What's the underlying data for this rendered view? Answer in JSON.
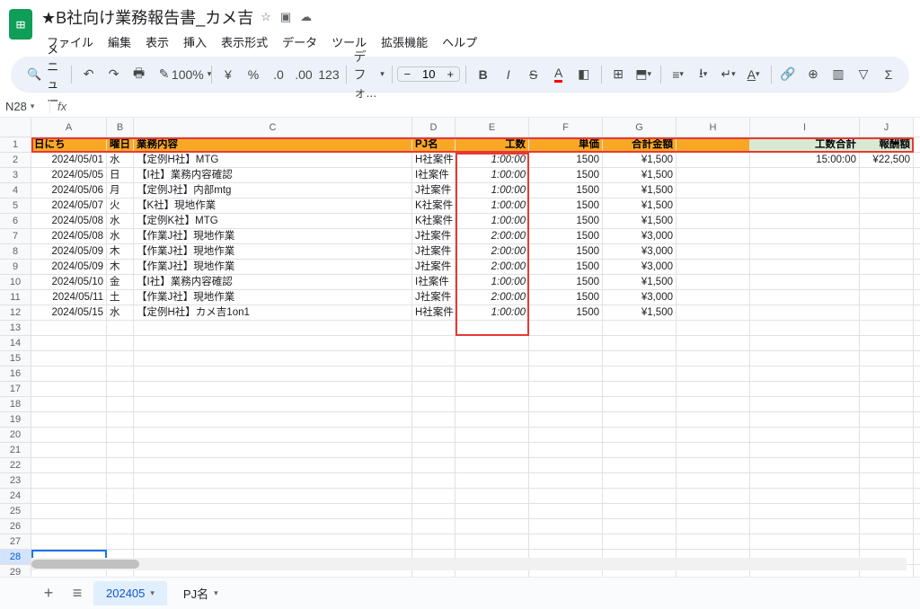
{
  "header": {
    "doc_title": "★B社向け業務報告書_カメ吉",
    "menu": [
      "ファイル",
      "編集",
      "表示",
      "挿入",
      "表示形式",
      "データ",
      "ツール",
      "拡張機能",
      "ヘルプ"
    ]
  },
  "toolbar": {
    "menu_label": "メニュー",
    "zoom": "100%",
    "font": "デフォ...",
    "font_size": "10"
  },
  "name_box": "N28",
  "columns": [
    "A",
    "B",
    "C",
    "D",
    "E",
    "F",
    "G",
    "H",
    "I",
    "J"
  ],
  "row_count": 29,
  "selected_row": 28,
  "table_headers": {
    "A": "日にち",
    "B": "曜日",
    "C": "業務内容",
    "D": "PJ名",
    "E": "工数",
    "F": "単価",
    "G": "合計金額",
    "H": "",
    "I": "工数合計",
    "J": "報酬額"
  },
  "rows": [
    {
      "date": "2024/05/01",
      "day": "水",
      "task": "【定例H社】MTG",
      "pj": "H社案件",
      "hours": "1:00:00",
      "unit": "1500",
      "total": "¥1,500",
      "sum_hours": "15:00:00",
      "pay": "¥22,500"
    },
    {
      "date": "2024/05/05",
      "day": "日",
      "task": "【I社】業務内容確認",
      "pj": "I社案件",
      "hours": "1:00:00",
      "unit": "1500",
      "total": "¥1,500"
    },
    {
      "date": "2024/05/06",
      "day": "月",
      "task": "【定例J社】内部mtg",
      "pj": "J社案件",
      "hours": "1:00:00",
      "unit": "1500",
      "total": "¥1,500"
    },
    {
      "date": "2024/05/07",
      "day": "火",
      "task": "【K社】現地作業",
      "pj": "K社案件",
      "hours": "1:00:00",
      "unit": "1500",
      "total": "¥1,500"
    },
    {
      "date": "2024/05/08",
      "day": "水",
      "task": "【定例K社】MTG",
      "pj": "K社案件",
      "hours": "1:00:00",
      "unit": "1500",
      "total": "¥1,500"
    },
    {
      "date": "2024/05/08",
      "day": "水",
      "task": "【作業J社】現地作業",
      "pj": "J社案件",
      "hours": "2:00:00",
      "unit": "1500",
      "total": "¥3,000"
    },
    {
      "date": "2024/05/09",
      "day": "木",
      "task": "【作業J社】現地作業",
      "pj": "J社案件",
      "hours": "2:00:00",
      "unit": "1500",
      "total": "¥3,000"
    },
    {
      "date": "2024/05/09",
      "day": "木",
      "task": "【作業J社】現地作業",
      "pj": "J社案件",
      "hours": "2:00:00",
      "unit": "1500",
      "total": "¥3,000"
    },
    {
      "date": "2024/05/10",
      "day": "金",
      "task": "【I社】業務内容確認",
      "pj": "I社案件",
      "hours": "1:00:00",
      "unit": "1500",
      "total": "¥1,500"
    },
    {
      "date": "2024/05/11",
      "day": "土",
      "task": "【作業J社】現地作業",
      "pj": "J社案件",
      "hours": "2:00:00",
      "unit": "1500",
      "total": "¥3,000"
    },
    {
      "date": "2024/05/15",
      "day": "水",
      "task": "【定例H社】カメ吉1on1",
      "pj": "H社案件",
      "hours": "1:00:00",
      "unit": "1500",
      "total": "¥1,500"
    }
  ],
  "sheets": {
    "active": "202405",
    "other": "PJ名"
  }
}
